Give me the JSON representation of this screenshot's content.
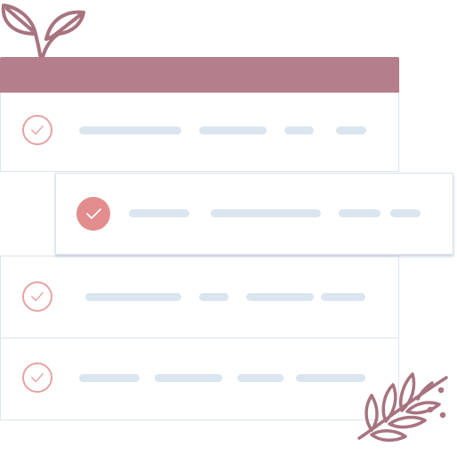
{
  "colors": {
    "header": "#b47f8b",
    "check": "#e6a2a2",
    "check_filled": "#e38d8f",
    "placeholder_line": "#dbe5ef",
    "leaf": "#a7737f",
    "card_border": "#dbe4ee"
  },
  "header": {
    "icon": "sprout-leaf-icon"
  },
  "rows": [
    {
      "status": "done",
      "icon": "checkmark-circle-outline-icon"
    },
    {
      "status": "done-highlighted",
      "icon": "checkmark-circle-filled-icon"
    },
    {
      "status": "done",
      "icon": "checkmark-circle-outline-icon"
    },
    {
      "status": "done",
      "icon": "checkmark-circle-outline-icon"
    }
  ],
  "decorations": [
    "sprout-leaf-icon",
    "fern-branch-icon"
  ]
}
